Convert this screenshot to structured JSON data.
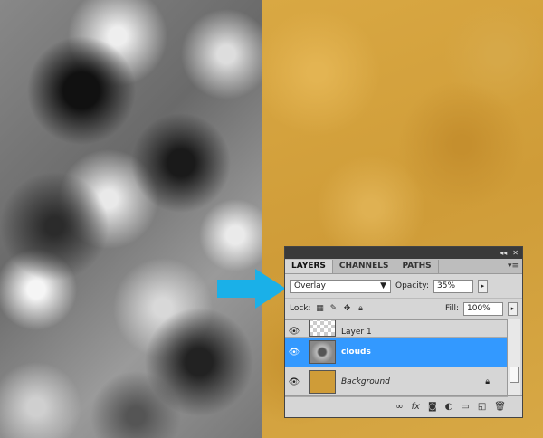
{
  "panel": {
    "tabs": [
      "LAYERS",
      "CHANNELS",
      "PATHS"
    ],
    "blend_mode": "Overlay",
    "opacity_label": "Opacity:",
    "opacity_value": "35%",
    "lock_label": "Lock:",
    "fill_label": "Fill:",
    "fill_value": "100%",
    "layers": [
      {
        "name": "Layer 1",
        "thumb": "transparent",
        "visible": true,
        "selected": false
      },
      {
        "name": "clouds",
        "thumb": "clouds",
        "visible": true,
        "selected": true
      },
      {
        "name": "Background",
        "thumb": "gold",
        "visible": true,
        "selected": false,
        "locked": true
      }
    ],
    "selection_color": "#3399ff"
  },
  "arrow_color": "#1ab0e8",
  "icons": {
    "titlebar": [
      "collapse-icon",
      "close-icon"
    ],
    "panel_menu": "panel-menu-icon",
    "lock": [
      "lock-transparent-icon",
      "lock-paint-icon",
      "lock-move-icon",
      "lock-all-icon"
    ],
    "bottom": [
      "link-layers-icon",
      "fx-icon",
      "mask-icon",
      "adjustment-icon",
      "group-icon",
      "new-layer-icon",
      "trash-icon"
    ]
  }
}
